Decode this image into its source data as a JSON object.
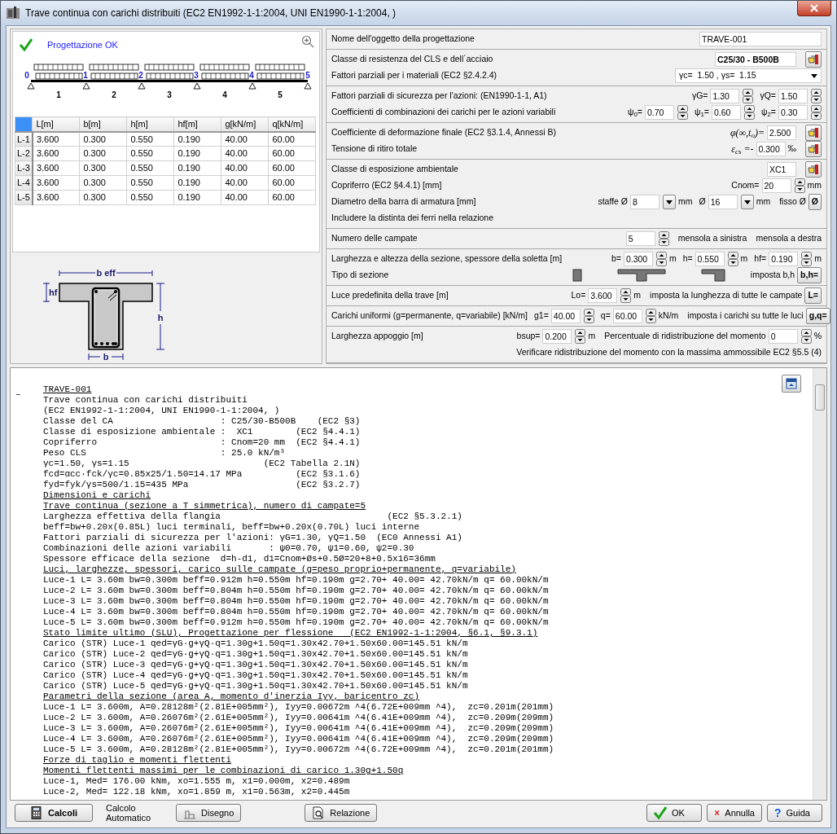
{
  "window": {
    "title": "Trave continua con carichi distribuiti (EC2 EN1992-1-1:2004, UNI EN1990-1-1:2004, )"
  },
  "status": {
    "ok": true,
    "text": "Progettazione OK"
  },
  "beam": {
    "nodes": [
      "0",
      "1",
      "2",
      "3",
      "4",
      "5"
    ],
    "spans": [
      "1",
      "2",
      "3",
      "4",
      "5"
    ]
  },
  "table": {
    "columns": [
      "L[m]",
      "b[m]",
      "h[m]",
      "hf[m]",
      "g[kN/m]",
      "q[kN/m]"
    ],
    "rows": [
      {
        "label": "L-1",
        "cells": [
          "3.600",
          "0.300",
          "0.550",
          "0.190",
          "40.00",
          "60.00"
        ]
      },
      {
        "label": "L-2",
        "cells": [
          "3.600",
          "0.300",
          "0.550",
          "0.190",
          "40.00",
          "60.00"
        ]
      },
      {
        "label": "L-3",
        "cells": [
          "3.600",
          "0.300",
          "0.550",
          "0.190",
          "40.00",
          "60.00"
        ]
      },
      {
        "label": "L-4",
        "cells": [
          "3.600",
          "0.300",
          "0.550",
          "0.190",
          "40.00",
          "60.00"
        ]
      },
      {
        "label": "L-5",
        "cells": [
          "3.600",
          "0.300",
          "0.550",
          "0.190",
          "40.00",
          "60.00"
        ]
      }
    ]
  },
  "section": {
    "beff": "b eff",
    "hf": "hf",
    "h": "h",
    "b": "b"
  },
  "form": [
    {
      "rows": [
        {
          "label": "Nome dell'oggetto della progettazione",
          "items": [
            {
              "kind": "text_field",
              "value": "TRAVE-001",
              "bold": false
            }
          ]
        }
      ]
    },
    {
      "rows": [
        {
          "label": "Classe di resistenza del CLS e dell´acciaio",
          "items": [
            {
              "kind": "text_field",
              "value": "C25/30 - B500B",
              "bold": true
            },
            {
              "kind": "lookup_button"
            }
          ]
        },
        {
          "label": "Fattori parziali per i materiali (EC2 §2.4.2.4)",
          "items": [
            {
              "kind": "select",
              "value": "γc=  1.50 , γs=  1.15"
            }
          ]
        }
      ]
    },
    {
      "rows": [
        {
          "label": "Fattori parziali di sicurezza per l'azioni: (EN1990-1-1, A1)",
          "items": [
            {
              "kind": "symbol",
              "text": "γG=",
              "italic": false
            },
            {
              "kind": "spin",
              "value": "1.30"
            },
            {
              "kind": "symbol",
              "text": "γQ=",
              "italic": false
            },
            {
              "kind": "spin",
              "value": "1.50"
            }
          ]
        },
        {
          "label": "Coefficienti di combinazioni dei carichi per le azioni variabili",
          "items": [
            {
              "kind": "symbol",
              "text": "ψ$_{0}$=",
              "italic": false
            },
            {
              "kind": "spin",
              "value": "0.70"
            },
            {
              "kind": "symbol",
              "text": "ψ$_{1}$=",
              "italic": false
            },
            {
              "kind": "spin",
              "value": "0.60"
            },
            {
              "kind": "symbol",
              "text": "ψ$_{2}$=",
              "italic": false
            },
            {
              "kind": "spin",
              "value": "0.30"
            }
          ]
        }
      ]
    },
    {
      "rows": [
        {
          "label": "Coefficiente di deformazione finale (EC2 §3.1.4, Annessi B)",
          "items": [
            {
              "kind": "symbol",
              "text": "φ(∞,t$_{o}$)=",
              "italic": true
            },
            {
              "kind": "field",
              "value": "2.500"
            },
            {
              "kind": "lookup_button"
            }
          ]
        },
        {
          "label": "Tensione di ritiro totale",
          "items": [
            {
              "kind": "symbol",
              "text": "ε$_{cs}$ =-",
              "italic": true
            },
            {
              "kind": "field",
              "value": "0.300"
            },
            {
              "kind": "unit",
              "text": "‰"
            },
            {
              "kind": "lookup_button"
            }
          ]
        }
      ]
    },
    {
      "rows": [
        {
          "label": "Classe di esposizione ambientale",
          "items": [
            {
              "kind": "field",
              "value": "XC1"
            },
            {
              "kind": "lookup_button"
            }
          ]
        },
        {
          "label": "Copriferro (EC2 §4.4.1) [mm]",
          "items": [
            {
              "kind": "symbol",
              "text": "Cnom=",
              "italic": false
            },
            {
              "kind": "spin",
              "value": "20"
            },
            {
              "kind": "unit",
              "text": "mm"
            }
          ]
        },
        {
          "label": "Diametro della barra di armatura [mm]",
          "items": [
            {
              "kind": "note",
              "text": "staffe Ø"
            },
            {
              "kind": "combo",
              "value": "8"
            },
            {
              "kind": "unit",
              "text": "mm"
            },
            {
              "kind": "symbol",
              "text": "Ø",
              "italic": false
            },
            {
              "kind": "combo",
              "value": "16"
            },
            {
              "kind": "unit",
              "text": "mm"
            },
            {
              "kind": "note",
              "text": "fisso Ø"
            },
            {
              "kind": "text_button",
              "label": "Ø"
            }
          ]
        },
        {
          "label": "Includere la distinta dei ferri nella relazione",
          "items": []
        }
      ]
    },
    {
      "rows": [
        {
          "label": "Numero delle campate",
          "items": [
            {
              "kind": "spin",
              "value": "5"
            },
            {
              "kind": "note",
              "text": "mensola a sinistra"
            },
            {
              "kind": "note",
              "text": "mensola a destra"
            }
          ]
        }
      ]
    },
    {
      "rows": [
        {
          "label": "Larghezza e altezza della sezione, spessore della soletta [m]",
          "items": [
            {
              "kind": "symbol",
              "text": "b=",
              "italic": false
            },
            {
              "kind": "spin",
              "value": "0.300"
            },
            {
              "kind": "unit",
              "text": "m"
            },
            {
              "kind": "symbol",
              "text": "h=",
              "italic": false
            },
            {
              "kind": "spin",
              "value": "0.550"
            },
            {
              "kind": "unit",
              "text": "m"
            },
            {
              "kind": "symbol",
              "text": "hf=",
              "italic": false
            },
            {
              "kind": "spin",
              "value": "0.190"
            },
            {
              "kind": "unit",
              "text": "m"
            }
          ]
        },
        {
          "label": "Tipo di sezione",
          "items": [
            {
              "kind": "shape_rect"
            },
            {
              "kind": "shape_tee"
            },
            {
              "kind": "shape_ell"
            },
            {
              "kind": "note",
              "text": "imposta b,h"
            },
            {
              "kind": "text_button",
              "label": "b,h="
            }
          ]
        }
      ]
    },
    {
      "rows": [
        {
          "label": "Luce predefinita della trave [m]",
          "items": [
            {
              "kind": "symbol",
              "text": "Lo=",
              "italic": false
            },
            {
              "kind": "spin",
              "value": "3.600"
            },
            {
              "kind": "unit",
              "text": "m"
            },
            {
              "kind": "note",
              "text": "imposta la lunghezza di tutte le campate"
            },
            {
              "kind": "text_button",
              "label": "L="
            }
          ]
        }
      ]
    },
    {
      "rows": [
        {
          "label": "Carichi uniformi (g=permanente, q=variabile) [kN/m]",
          "items": [
            {
              "kind": "symbol",
              "text": "g1=",
              "italic": false
            },
            {
              "kind": "spin",
              "value": "40.00"
            },
            {
              "kind": "symbol",
              "text": "q=",
              "italic": false
            },
            {
              "kind": "spin",
              "value": "60.00"
            },
            {
              "kind": "unit",
              "text": "kN/m"
            },
            {
              "kind": "note",
              "text": "imposta i carichi su tutte le luci"
            },
            {
              "kind": "text_button",
              "label": "g,q="
            }
          ]
        }
      ]
    },
    {
      "rows": [
        {
          "label": "Larghezza appoggio [m]",
          "items": [
            {
              "kind": "symbol",
              "text": "bsup=",
              "italic": false
            },
            {
              "kind": "spin",
              "value": "0.200"
            },
            {
              "kind": "unit",
              "text": "m"
            },
            {
              "kind": "note",
              "text": "Percentuale di ridistribuzione del momento"
            },
            {
              "kind": "spin",
              "value": "0"
            },
            {
              "kind": "unit",
              "text": "%"
            }
          ]
        },
        {
          "label": "",
          "items": [
            {
              "kind": "note",
              "text": "Verificare ridistribuzione del momento con la massima ammossibile EC2  §5.5 (4)"
            }
          ]
        }
      ]
    }
  ],
  "report": {
    "marker": "–",
    "lines": [
      {
        "text": "TRAVE-001",
        "underline": true
      },
      {
        "text": "Trave continua con carichi distribuiti",
        "underline": false
      },
      {
        "text": "(EC2 EN1992-1-1:2004, UNI EN1990-1-1:2004, )",
        "underline": false
      },
      {
        "text": "Classe del CA                    : C25/30-B500B    (EC2 §3)",
        "underline": false
      },
      {
        "text": "Classe di esposizione ambientale :  XC1        (EC2 §4.4.1)",
        "underline": false
      },
      {
        "text": "Copriferro                       : Cnom=20 mm  (EC2 §4.4.1)",
        "underline": false
      },
      {
        "text": "Peso CLS                         : 25.0 kN/m³",
        "underline": false
      },
      {
        "text": "γc=1.50, γs=1.15                         (EC2 Tabella 2.1N)",
        "underline": false
      },
      {
        "text": "fcd=αcc·fck/γc=0.85x25/1.50=14.17 MPa          (EC2 §3.1.6)",
        "underline": false
      },
      {
        "text": "fyd=fyk/γs=500/1.15=435 MPa                    (EC2 §3.2.7)",
        "underline": false
      },
      {
        "text": "Dimensioni e carichi",
        "underline": true
      },
      {
        "text": "Trave continua (sezione a T simmetrica), numero di campate=5",
        "underline": true
      },
      {
        "text": "Larghezza effettiva della flangia                               (EC2 §5.3.2.1)",
        "underline": false
      },
      {
        "text": "beff=bw+0.20x(0.85L) luci terminali, beff=bw+0.20x(0.70L) luci interne",
        "underline": false
      },
      {
        "text": "Fattori parziali di sicurezza per l'azioni: γG=1.30, γQ=1.50  (EC0 Annessi A1)",
        "underline": false
      },
      {
        "text": "Combinazioni delle azioni variabili       : ψ0=0.70, ψ1=0.60, ψ2=0.30",
        "underline": false
      },
      {
        "text": "Spessore efficace della sezione  d=h-d1, d1=Cnom+Øs+0.5Ø=20+8+0.5x16=36mm",
        "underline": false
      },
      {
        "text": "Luci, larghezze, spessori, carico sulle campate (g=peso proprio+permanente, q=variabile)",
        "underline": true
      },
      {
        "text": "Luce-1 L= 3.60m bw=0.300m beff=0.912m h=0.550m hf=0.190m g=2.70+ 40.00= 42.70kN/m q= 60.00kN/m",
        "underline": false
      },
      {
        "text": "Luce-2 L= 3.60m bw=0.300m beff=0.804m h=0.550m hf=0.190m g=2.70+ 40.00= 42.70kN/m q= 60.00kN/m",
        "underline": false
      },
      {
        "text": "Luce-3 L= 3.60m bw=0.300m beff=0.804m h=0.550m hf=0.190m g=2.70+ 40.00= 42.70kN/m q= 60.00kN/m",
        "underline": false
      },
      {
        "text": "Luce-4 L= 3.60m bw=0.300m beff=0.804m h=0.550m hf=0.190m g=2.70+ 40.00= 42.70kN/m q= 60.00kN/m",
        "underline": false
      },
      {
        "text": "Luce-5 L= 3.60m bw=0.300m beff=0.912m h=0.550m hf=0.190m g=2.70+ 40.00= 42.70kN/m q= 60.00kN/m",
        "underline": false
      },
      {
        "text": "Stato limite ultimo (SLU), Progettazione per flessione   (EC2 EN1992-1-1:2004, §6.1, §9.3.1)",
        "underline": true
      },
      {
        "text": "Carico (STR) Luce-1 qed=γG·g+γQ·q=1.30g+1.50q=1.30x42.70+1.50x60.00=145.51 kN/m",
        "underline": false
      },
      {
        "text": "Carico (STR) Luce-2 qed=γG·g+γQ·q=1.30g+1.50q=1.30x42.70+1.50x60.00=145.51 kN/m",
        "underline": false
      },
      {
        "text": "Carico (STR) Luce-3 qed=γG·g+γQ·q=1.30g+1.50q=1.30x42.70+1.50x60.00=145.51 kN/m",
        "underline": false
      },
      {
        "text": "Carico (STR) Luce-4 qed=γG·g+γQ·q=1.30g+1.50q=1.30x42.70+1.50x60.00=145.51 kN/m",
        "underline": false
      },
      {
        "text": "Carico (STR) Luce-5 qed=γG·g+γQ·q=1.30g+1.50q=1.30x42.70+1.50x60.00=145.51 kN/m",
        "underline": false
      },
      {
        "text": "Parametri della sezione (area A, momento d'inerzia Iyy, baricentro zc)",
        "underline": true
      },
      {
        "text": "Luce-1 L= 3.600m, A=0.28128m²(2.81E+005mm²), Iyy=0.00672m ^4(6.72E+009mm ^4),  zc=0.201m(201mm)",
        "underline": false
      },
      {
        "text": "Luce-2 L= 3.600m, A=0.26076m²(2.61E+005mm²), Iyy=0.00641m ^4(6.41E+009mm ^4),  zc=0.209m(209mm)",
        "underline": false
      },
      {
        "text": "Luce-3 L= 3.600m, A=0.26076m²(2.61E+005mm²), Iyy=0.00641m ^4(6.41E+009mm ^4),  zc=0.209m(209mm)",
        "underline": false
      },
      {
        "text": "Luce-4 L= 3.600m, A=0.26076m²(2.61E+005mm²), Iyy=0.00641m ^4(6.41E+009mm ^4),  zc=0.209m(209mm)",
        "underline": false
      },
      {
        "text": "Luce-5 L= 3.600m, A=0.28128m²(2.81E+005mm²), Iyy=0.00672m ^4(6.72E+009mm ^4),  zc=0.201m(201mm)",
        "underline": false
      },
      {
        "text": "Forze di taglio e momenti flettenti",
        "underline": true
      },
      {
        "text": "Momenti flettenti massimi per le combinazioni di carico 1.30g+1.50q",
        "underline": true
      },
      {
        "text": "Luce-1, Med= 176.00 kNm, xo=1.555 m, x1=0.000m, x2=0.489m",
        "underline": false
      },
      {
        "text": "Luce-2, Med= 122.18 kNm, xo=1.859 m, x1=0.563m, x2=0.445m",
        "underline": false
      }
    ]
  },
  "footer": [
    {
      "kind": "calc",
      "label": "Calcoli"
    },
    {
      "kind": "note",
      "label": "Calcolo Automatico"
    },
    {
      "kind": "draw",
      "label": "Disegno"
    },
    {
      "kind": "report",
      "label": "Relazione"
    },
    {
      "kind": "ok",
      "label": "OK"
    },
    {
      "kind": "cancel",
      "label": "Annulla"
    },
    {
      "kind": "help",
      "label": "Guida",
      "icon": "?"
    }
  ]
}
